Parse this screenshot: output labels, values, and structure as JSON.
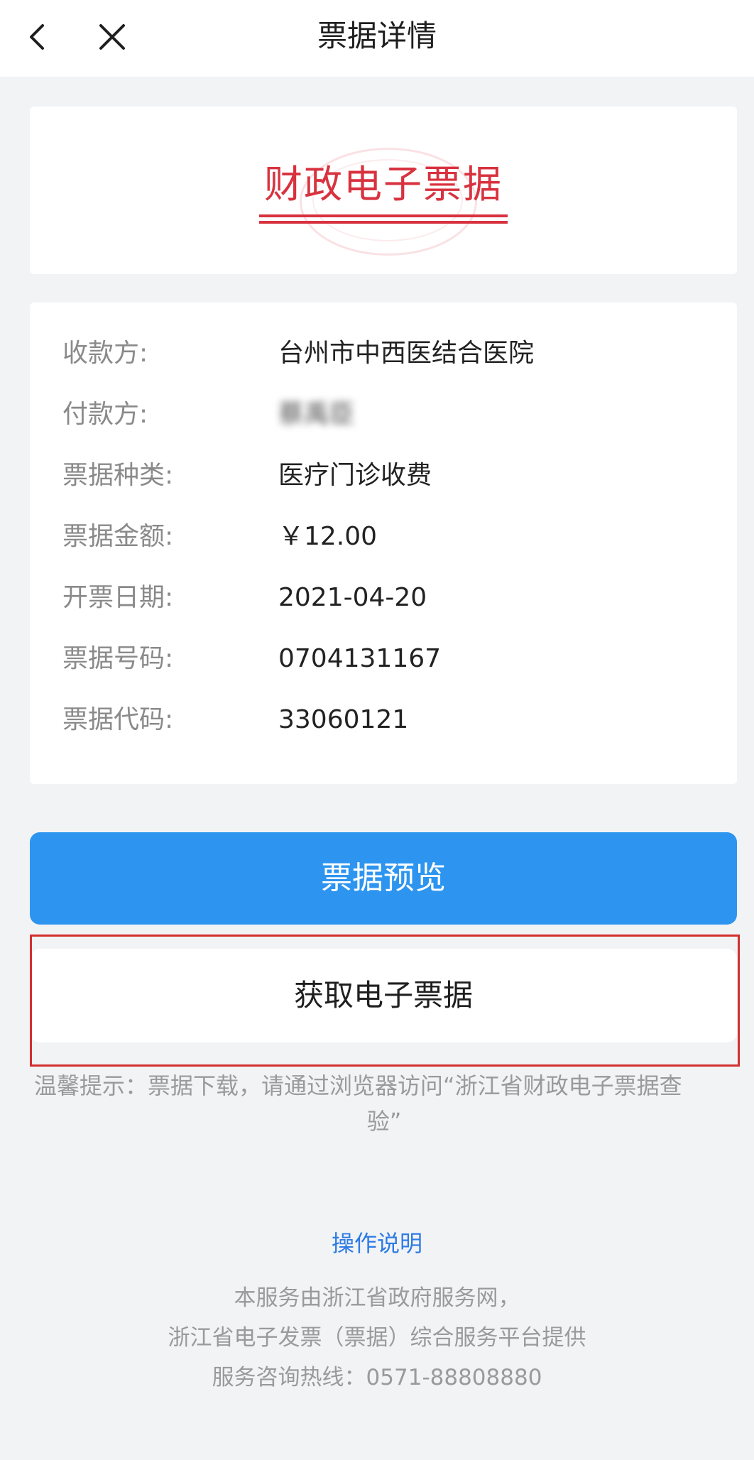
{
  "header": {
    "title": "票据详情",
    "back_icon": "chevron-left-icon",
    "close_icon": "close-icon"
  },
  "invoice_header": {
    "title": "财政电子票据"
  },
  "details": [
    {
      "label": "收款方:",
      "value": "台州市中西医结合医院"
    },
    {
      "label": "付款方:",
      "value": "蔡禹臣"
    },
    {
      "label": "票据种类:",
      "value": "医疗门诊收费"
    },
    {
      "label": "票据金额:",
      "value": "￥12.00"
    },
    {
      "label": "开票日期:",
      "value": "2021-04-20"
    },
    {
      "label": "票据号码:",
      "value": "0704131167"
    },
    {
      "label": "票据代码:",
      "value": "33060121"
    }
  ],
  "buttons": {
    "preview": "票据预览",
    "get_invoice": "获取电子票据"
  },
  "tip": {
    "line1": "温馨提示：票据下载，请通过浏览器访问“浙江省财政电子票据查",
    "line2": "验”"
  },
  "guide_link": "操作说明",
  "footer": {
    "line1": "本服务由浙江省政府服务网，",
    "line2": "浙江省电子发票（票据）综合服务平台提供",
    "line3": "服务咨询热线：0571-88808880"
  },
  "colors": {
    "primary_blue": "#2d95f0",
    "invoice_red": "#d8323f",
    "highlight_red": "#d32f2f"
  }
}
